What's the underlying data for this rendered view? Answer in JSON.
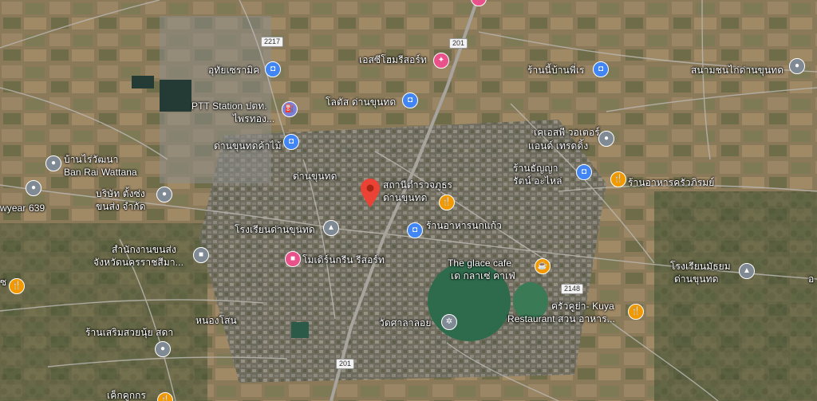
{
  "map": {
    "type": "satellite",
    "colors": {
      "road": "#b9b6b0",
      "highway": "#9e9a96",
      "water": "#2e6b4c",
      "field": "#7a6a4e",
      "selected_pin": "#ea4335"
    },
    "selected_pin": {
      "name": "red-location-pin"
    },
    "route_shields": {
      "r2217": "2217",
      "r201_top": "201",
      "r201_bottom": "201",
      "r2148": "2148"
    },
    "labels": {
      "eslite": "เอสซีโฮมรีสอร์ท",
      "utai_ceramic": "อุทัยเซรามิค",
      "ban_nai": "ร้านนี้บ้านพี่เร",
      "sanam_chon": "สนามชนไก่ด่านขุนทด",
      "lotus": "โลตัส ด่านขุนทด",
      "ptt1": "PTT Station ปตท.",
      "ptt2": "ไพรทอง...",
      "dan_khun_thot_kamai": "ด่านขุนทดค้าไม้",
      "ks_water1": "เคเอสพี วอเตอร์",
      "ks_water2": "แอนด์ เทรดดิ้ง",
      "ban_rai1": "บ้านไร่วัฒนา",
      "ban_rai2": "Ban Rai Wattana",
      "thanya1": "ร้านธัญญา",
      "thanya2": "รัตน์ อะไหล่",
      "dan_khun_thot_town": "ด่านขุนทด",
      "police1": "สถานีตำรวจภูธร",
      "police2": "ด่านขุนทด",
      "krua_phirom": "ร้านอาหารครัวภิรมย์",
      "tyre": "wyear 639",
      "company1": "บริษัท ตั้งซ่ง",
      "company2": "ขนส่ง จำกัด",
      "school": "โรงเรียนด่านขุนทด",
      "noknkaew": "ร้านอาหารนกแก้ว",
      "office1": "สำนักงานขนส่ง",
      "office2": "จังหวัดนครราชสีมา...",
      "modern_resort": "โมเดิร์นกรีน รีสอร์ท",
      "glace1": "The glace cafe",
      "glace2": "เด กลาเซ่ คาเฟ่",
      "secondary1": "โรงเรียนมัธยม",
      "secondary2": "ด่านขุนทด",
      "kuya1": "ครัวคูย่า- Kuya",
      "kuya2": "Restaurant สวน อาหาร...",
      "nong_sano": "หนองโสน",
      "wat_sala": "วัดศาลาลอย",
      "salon": "ร้านเสริมสวยนุ้ย สดา",
      "edge_left": "ซ",
      "edge_right": "อ",
      "bottom_cut": "เค็กคูกกร"
    },
    "pins": [
      {
        "name": "gray-place-pin",
        "kind": "place"
      },
      {
        "name": "blue-shopping-pin",
        "kind": "shopping"
      },
      {
        "name": "orange-restaurant-pin",
        "kind": "restaurant"
      },
      {
        "name": "pink-hotel-pin",
        "kind": "hotel"
      },
      {
        "name": "gray-school-pin",
        "kind": "school"
      },
      {
        "name": "violet-gas-station-pin",
        "kind": "gas"
      },
      {
        "name": "gray-temple-pin",
        "kind": "temple"
      },
      {
        "name": "gray-government-pin",
        "kind": "government"
      }
    ]
  }
}
